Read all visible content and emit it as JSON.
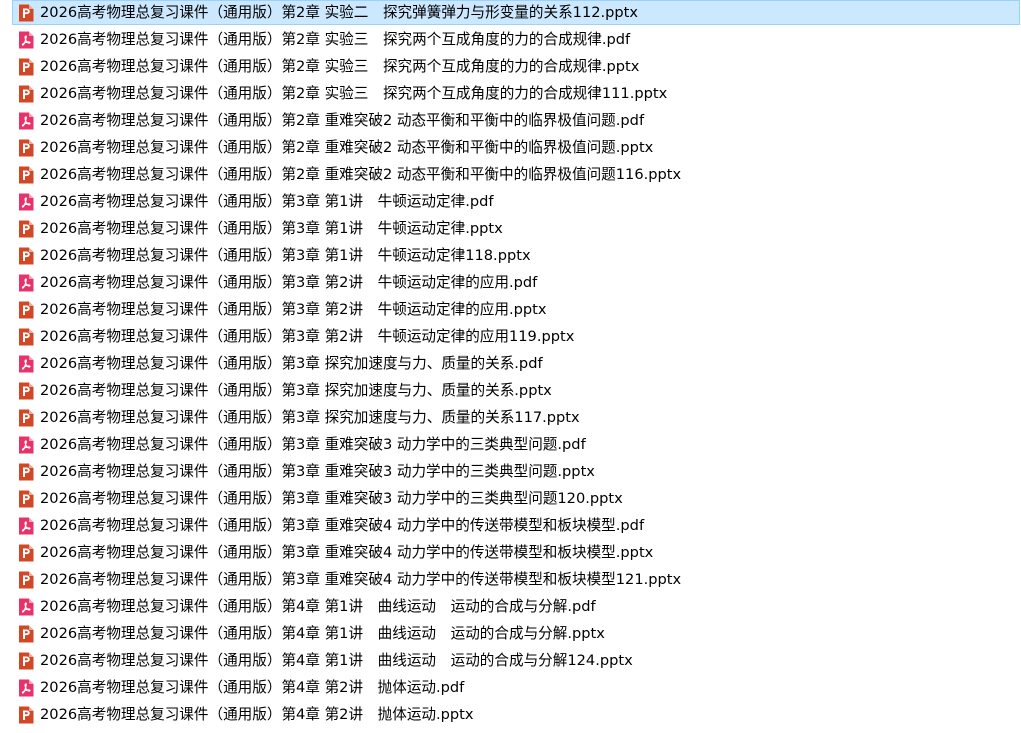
{
  "colors": {
    "pptx_icon": "#d24726",
    "pdf_icon": "#e8336a",
    "selection_bg": "#cce8ff",
    "selection_border": "#99d1ff"
  },
  "files": [
    {
      "name": "2026高考物理总复习课件（通用版）第2章 实验二　探究弹簧弹力与形变量的关系112.pptx",
      "type": "pptx",
      "icon": "powerpoint-icon",
      "selected": true
    },
    {
      "name": "2026高考物理总复习课件（通用版）第2章 实验三　探究两个互成角度的力的合成规律.pdf",
      "type": "pdf",
      "icon": "pdf-icon",
      "selected": false
    },
    {
      "name": "2026高考物理总复习课件（通用版）第2章 实验三　探究两个互成角度的力的合成规律.pptx",
      "type": "pptx",
      "icon": "powerpoint-icon",
      "selected": false
    },
    {
      "name": "2026高考物理总复习课件（通用版）第2章 实验三　探究两个互成角度的力的合成规律111.pptx",
      "type": "pptx",
      "icon": "powerpoint-icon",
      "selected": false
    },
    {
      "name": "2026高考物理总复习课件（通用版）第2章 重难突破2 动态平衡和平衡中的临界极值问题.pdf",
      "type": "pdf",
      "icon": "pdf-icon",
      "selected": false
    },
    {
      "name": "2026高考物理总复习课件（通用版）第2章 重难突破2 动态平衡和平衡中的临界极值问题.pptx",
      "type": "pptx",
      "icon": "powerpoint-icon",
      "selected": false
    },
    {
      "name": "2026高考物理总复习课件（通用版）第2章 重难突破2 动态平衡和平衡中的临界极值问题116.pptx",
      "type": "pptx",
      "icon": "powerpoint-icon",
      "selected": false
    },
    {
      "name": "2026高考物理总复习课件（通用版）第3章 第1讲　牛顿运动定律.pdf",
      "type": "pdf",
      "icon": "pdf-icon",
      "selected": false
    },
    {
      "name": "2026高考物理总复习课件（通用版）第3章 第1讲　牛顿运动定律.pptx",
      "type": "pptx",
      "icon": "powerpoint-icon",
      "selected": false
    },
    {
      "name": "2026高考物理总复习课件（通用版）第3章 第1讲　牛顿运动定律118.pptx",
      "type": "pptx",
      "icon": "powerpoint-icon",
      "selected": false
    },
    {
      "name": "2026高考物理总复习课件（通用版）第3章 第2讲　牛顿运动定律的应用.pdf",
      "type": "pdf",
      "icon": "pdf-icon",
      "selected": false
    },
    {
      "name": "2026高考物理总复习课件（通用版）第3章 第2讲　牛顿运动定律的应用.pptx",
      "type": "pptx",
      "icon": "powerpoint-icon",
      "selected": false
    },
    {
      "name": "2026高考物理总复习课件（通用版）第3章 第2讲　牛顿运动定律的应用119.pptx",
      "type": "pptx",
      "icon": "powerpoint-icon",
      "selected": false
    },
    {
      "name": "2026高考物理总复习课件（通用版）第3章 探究加速度与力、质量的关系.pdf",
      "type": "pdf",
      "icon": "pdf-icon",
      "selected": false
    },
    {
      "name": "2026高考物理总复习课件（通用版）第3章 探究加速度与力、质量的关系.pptx",
      "type": "pptx",
      "icon": "powerpoint-icon",
      "selected": false
    },
    {
      "name": "2026高考物理总复习课件（通用版）第3章 探究加速度与力、质量的关系117.pptx",
      "type": "pptx",
      "icon": "powerpoint-icon",
      "selected": false
    },
    {
      "name": "2026高考物理总复习课件（通用版）第3章 重难突破3 动力学中的三类典型问题.pdf",
      "type": "pdf",
      "icon": "pdf-icon",
      "selected": false
    },
    {
      "name": "2026高考物理总复习课件（通用版）第3章 重难突破3 动力学中的三类典型问题.pptx",
      "type": "pptx",
      "icon": "powerpoint-icon",
      "selected": false
    },
    {
      "name": "2026高考物理总复习课件（通用版）第3章 重难突破3 动力学中的三类典型问题120.pptx",
      "type": "pptx",
      "icon": "powerpoint-icon",
      "selected": false
    },
    {
      "name": "2026高考物理总复习课件（通用版）第3章 重难突破4 动力学中的传送带模型和板块模型.pdf",
      "type": "pdf",
      "icon": "pdf-icon",
      "selected": false
    },
    {
      "name": "2026高考物理总复习课件（通用版）第3章 重难突破4 动力学中的传送带模型和板块模型.pptx",
      "type": "pptx",
      "icon": "powerpoint-icon",
      "selected": false
    },
    {
      "name": "2026高考物理总复习课件（通用版）第3章 重难突破4 动力学中的传送带模型和板块模型121.pptx",
      "type": "pptx",
      "icon": "powerpoint-icon",
      "selected": false
    },
    {
      "name": "2026高考物理总复习课件（通用版）第4章 第1讲　曲线运动　运动的合成与分解.pdf",
      "type": "pdf",
      "icon": "pdf-icon",
      "selected": false
    },
    {
      "name": "2026高考物理总复习课件（通用版）第4章 第1讲　曲线运动　运动的合成与分解.pptx",
      "type": "pptx",
      "icon": "powerpoint-icon",
      "selected": false
    },
    {
      "name": "2026高考物理总复习课件（通用版）第4章 第1讲　曲线运动　运动的合成与分解124.pptx",
      "type": "pptx",
      "icon": "powerpoint-icon",
      "selected": false
    },
    {
      "name": "2026高考物理总复习课件（通用版）第4章 第2讲　抛体运动.pdf",
      "type": "pdf",
      "icon": "pdf-icon",
      "selected": false
    },
    {
      "name": "2026高考物理总复习课件（通用版）第4章 第2讲　抛体运动.pptx",
      "type": "pptx",
      "icon": "powerpoint-icon",
      "selected": false
    }
  ]
}
